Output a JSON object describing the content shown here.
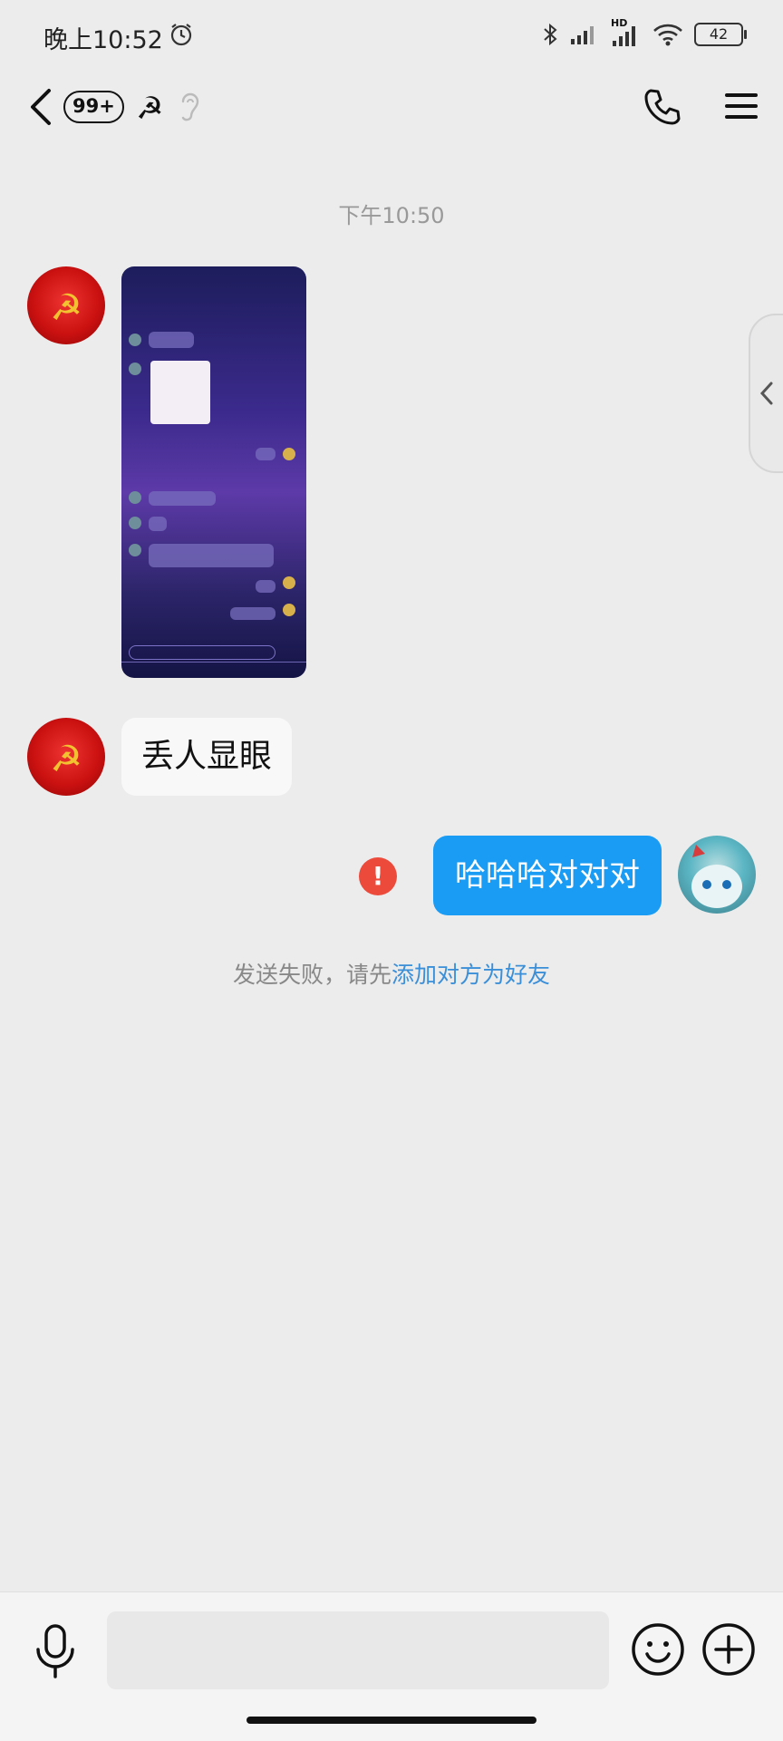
{
  "status_bar": {
    "time": "晚上10:52",
    "network": "HD",
    "battery": "42"
  },
  "nav": {
    "unread_badge": "99+",
    "title_icon": "☭"
  },
  "conversation": {
    "divider_time": "下午10:50",
    "messages": [
      {
        "from": "other",
        "type": "image",
        "avatar": "hammer-sickle",
        "sender_mark": "☭"
      },
      {
        "from": "other",
        "type": "text",
        "text": "丢人显眼"
      },
      {
        "from": "me",
        "type": "text",
        "text": "哈哈哈对对对",
        "status": "failed"
      }
    ],
    "fail_notice": {
      "prefix": "发送失败，请先",
      "link": "添加对方为好友"
    }
  },
  "colors": {
    "bubble_out": "#1a9cf4",
    "error": "#ec4a3b",
    "link": "#3b8fd8"
  }
}
